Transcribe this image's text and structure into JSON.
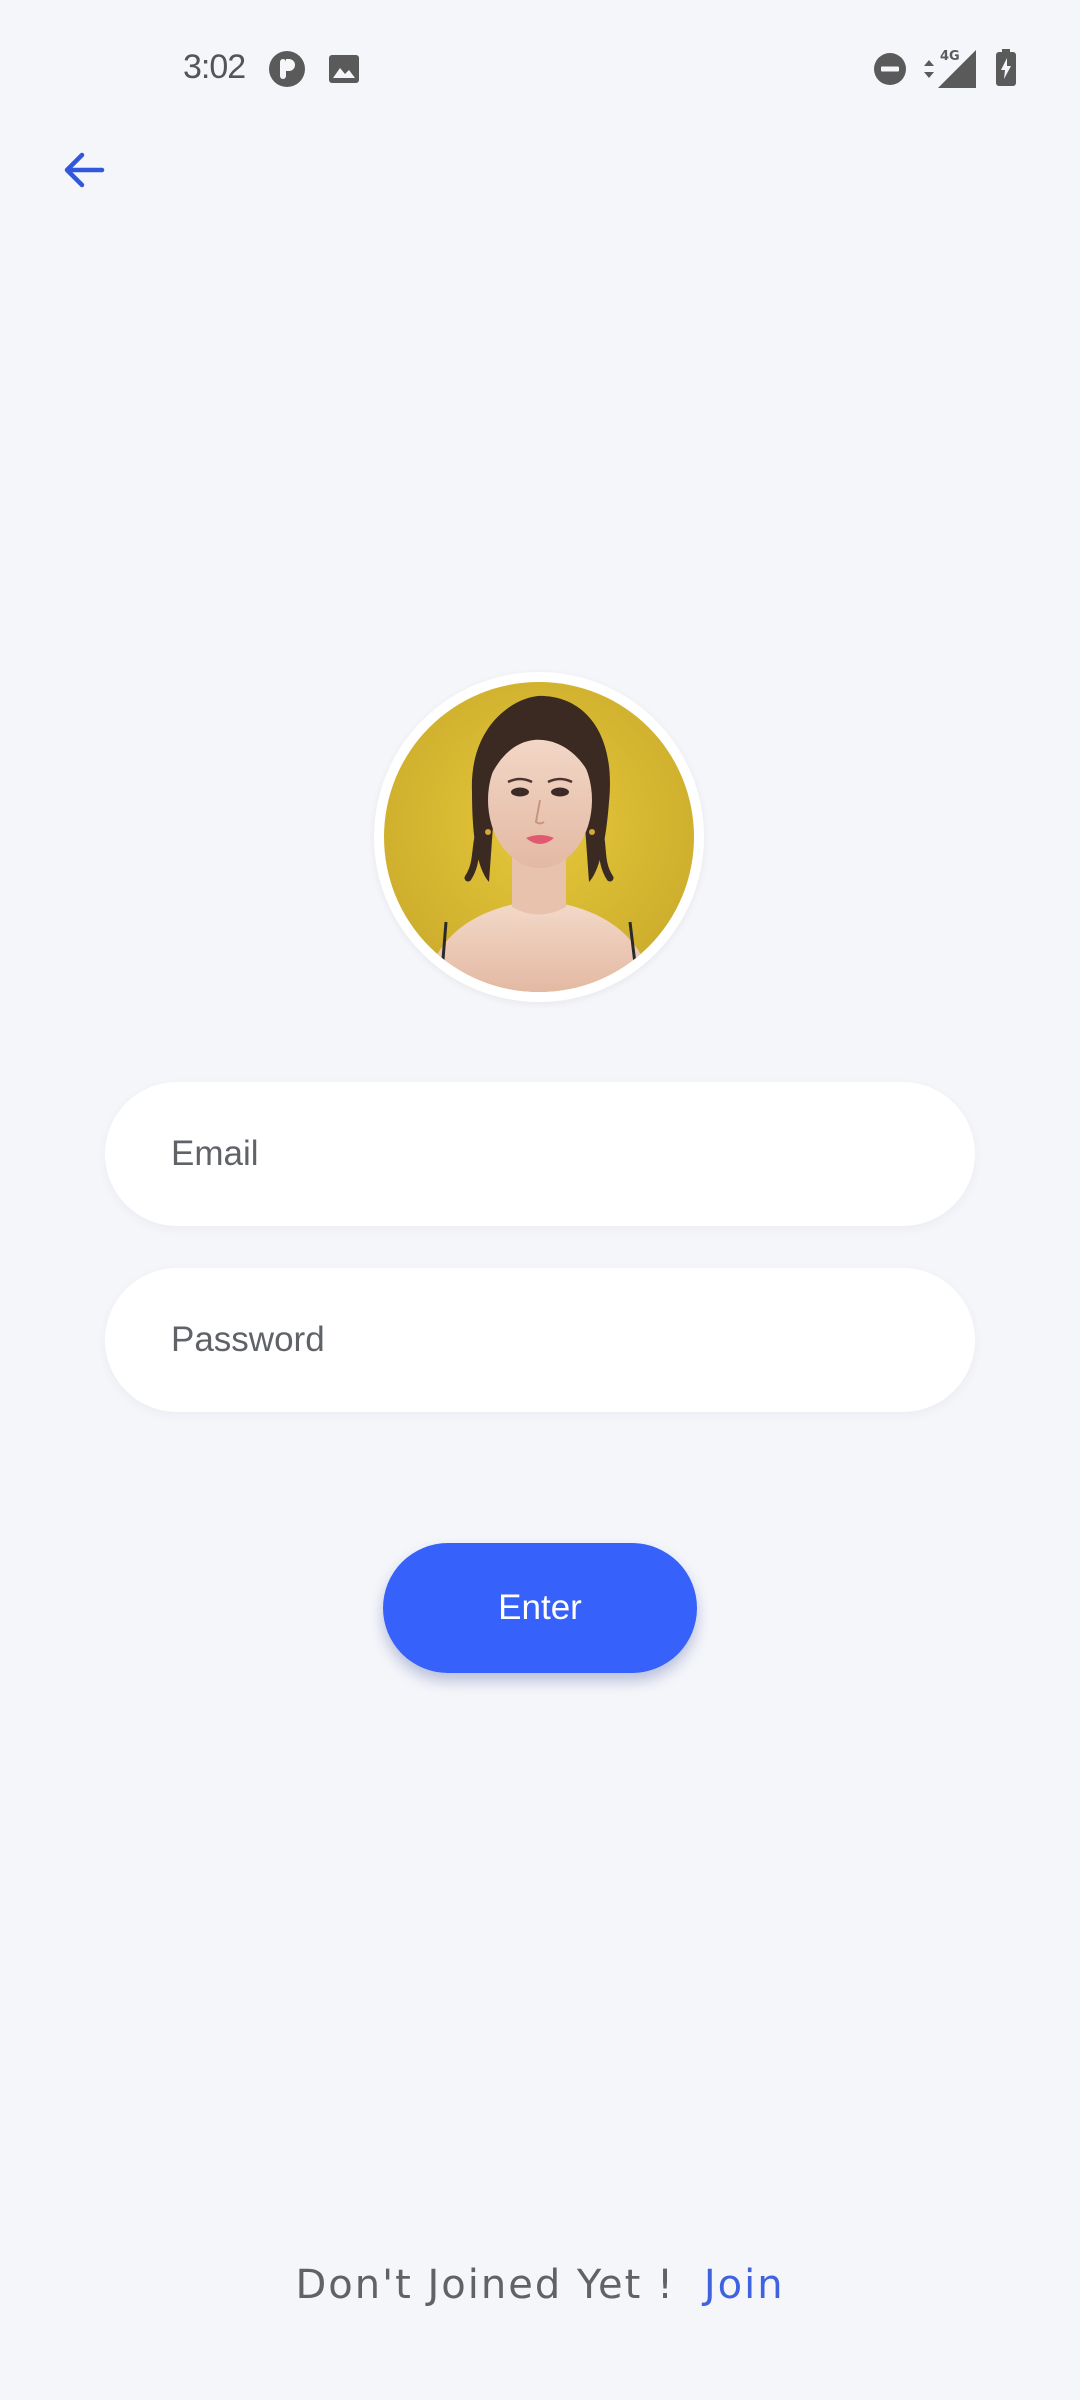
{
  "status_bar": {
    "time": "3:02",
    "network": "4G",
    "icons": [
      "p-app-icon",
      "image-icon",
      "do-not-disturb-icon",
      "data-arrows-icon",
      "signal-icon",
      "battery-icon"
    ]
  },
  "header": {
    "back_icon": "arrow-left-icon"
  },
  "profile": {
    "avatar_description": "avatar"
  },
  "form": {
    "email_placeholder": "Email",
    "password_placeholder": "Password",
    "submit_label": "Enter"
  },
  "footer": {
    "prompt": "Don't Joined Yet !",
    "link": "Join"
  },
  "colors": {
    "background": "#f5f6fa",
    "accent": "#3761fb",
    "link": "#3f63e0",
    "input_bg": "#ffffff"
  }
}
